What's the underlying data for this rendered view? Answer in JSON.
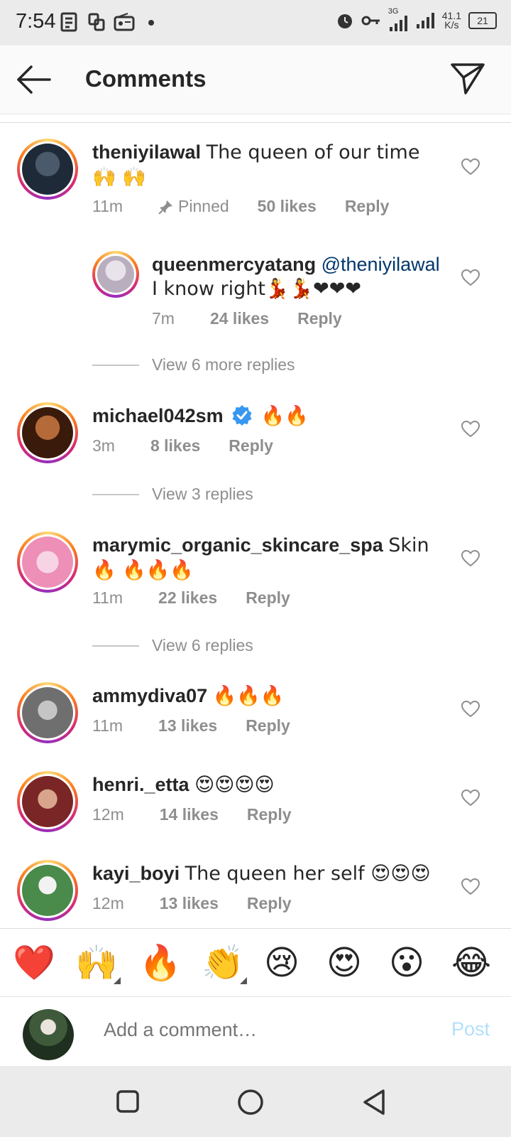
{
  "status_bar": {
    "time": "7:54",
    "network_type": "3G",
    "speed": "41.1",
    "speed_unit": "K/s",
    "battery": "21"
  },
  "header": {
    "title": "Comments",
    "back_icon": "arrow-left-icon",
    "share_icon": "paper-plane-icon"
  },
  "comments": [
    {
      "username": "theniyilawal",
      "text": "The queen of our time 🙌 🙌",
      "time": "11m",
      "pinned_label": "Pinned",
      "likes": "50 likes",
      "reply_label": "Reply",
      "avatar_color": "#2a3b4f"
    },
    {
      "username": "queenmercyatang",
      "mention": "@theniyilawal",
      "text": "I know right💃💃❤❤❤",
      "time": "7m",
      "likes": "24 likes",
      "reply_label": "Reply",
      "avatar_color": "#cfc6d4"
    },
    {
      "username": "michael042sm",
      "verified": true,
      "text": "🔥🔥",
      "time": "3m",
      "likes": "8 likes",
      "reply_label": "Reply",
      "avatar_color": "#7a3a14"
    },
    {
      "username": "marymic_organic_skincare_spa",
      "text": "Skin 🔥 🔥🔥🔥",
      "time": "11m",
      "likes": "22 likes",
      "reply_label": "Reply",
      "avatar_color": "#f2a8c8"
    },
    {
      "username": "ammydiva07",
      "text": "🔥🔥🔥",
      "time": "11m",
      "likes": "13 likes",
      "reply_label": "Reply",
      "avatar_color": "#8c8c8c"
    },
    {
      "username": "henri._etta",
      "text": "😍😍😍😍",
      "time": "12m",
      "likes": "14 likes",
      "reply_label": "Reply",
      "avatar_color": "#6b2a2a"
    },
    {
      "username": "kayi_boyi",
      "text": "The queen her self 😍😍😍",
      "time": "12m",
      "likes": "13 likes",
      "reply_label": "Reply",
      "avatar_color": "#3e7a3e"
    }
  ],
  "view_replies": [
    "View 6 more replies",
    "View 3 replies",
    "View 6 replies"
  ],
  "emoji_bar": [
    "❤️",
    "🙌",
    "🔥",
    "👏",
    "😢",
    "😍",
    "😮",
    "😂"
  ],
  "composer": {
    "placeholder": "Add a comment…",
    "post_label": "Post"
  },
  "colors": {
    "link": "#00376b",
    "meta": "#8e8e8e",
    "post_disabled": "#b2dffc",
    "verified": "#3897f0"
  }
}
